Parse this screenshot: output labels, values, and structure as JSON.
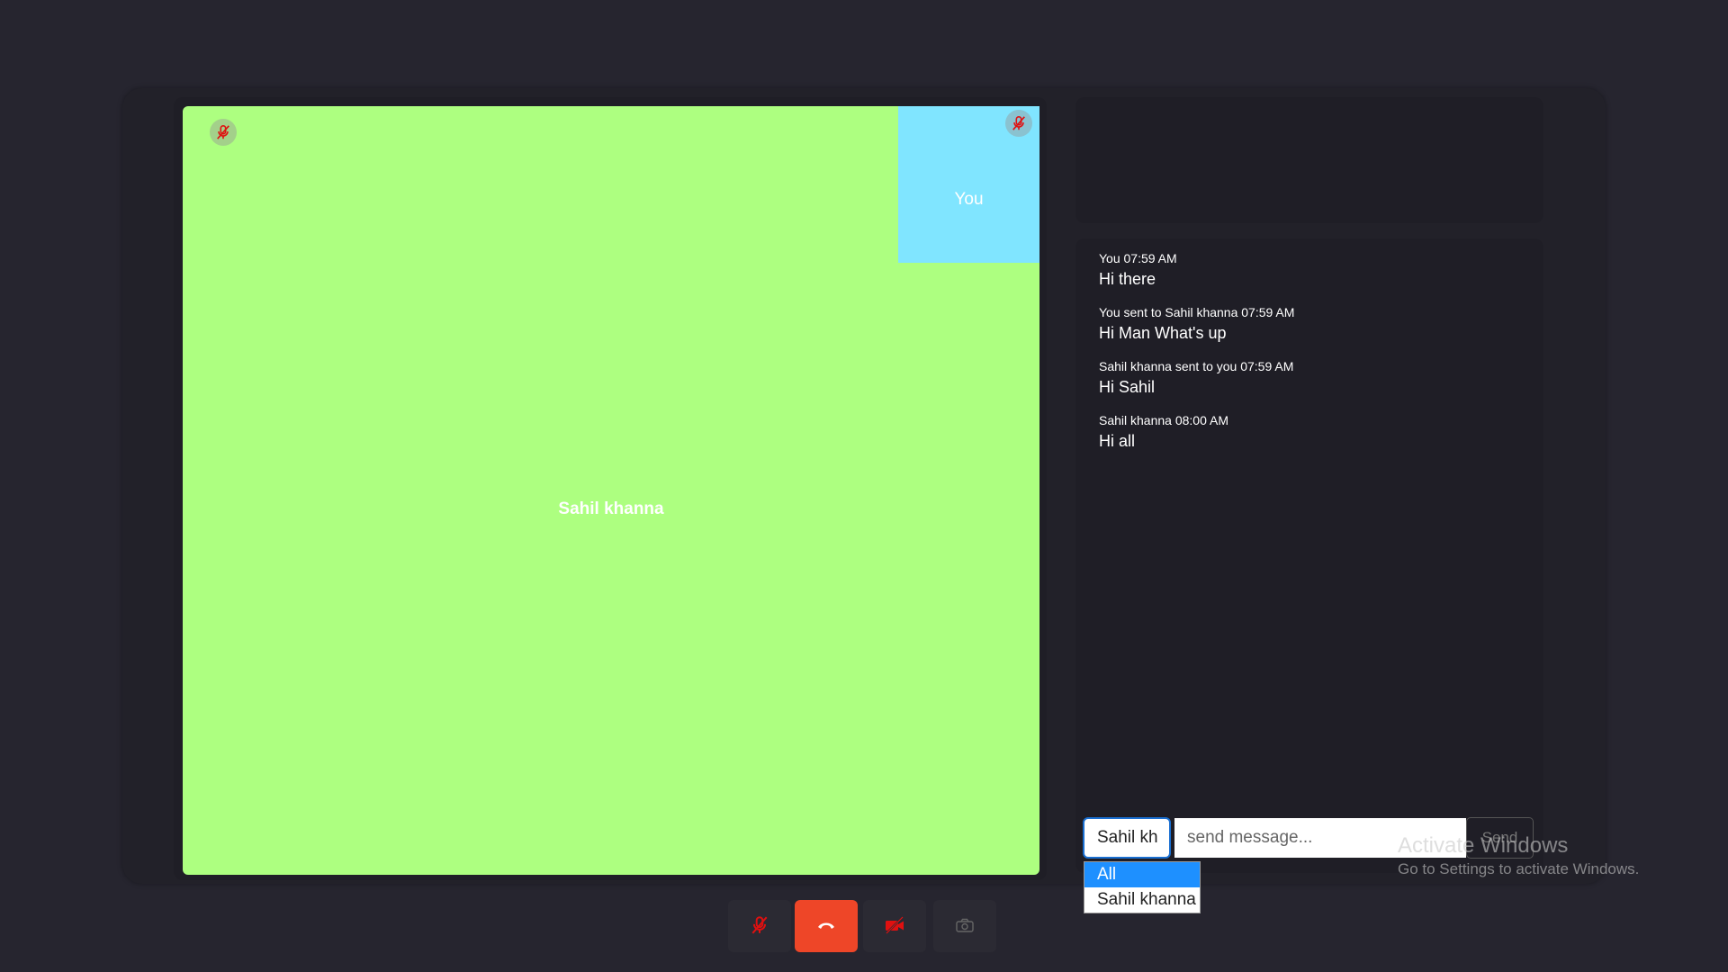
{
  "stage": {
    "main_participant": {
      "name": "Sahil khanna",
      "tile_color": "#adff80",
      "mic": "muted"
    },
    "self": {
      "name": "You",
      "tile_color": "#80e5ff",
      "mic": "muted"
    }
  },
  "chat": {
    "messages": [
      {
        "meta": "You 07:59 AM",
        "text": "Hi there"
      },
      {
        "meta": "You sent to Sahil khanna 07:59 AM",
        "text": "Hi Man What's up"
      },
      {
        "meta": "Sahil khanna sent to you 07:59 AM",
        "text": "Hi Sahil"
      },
      {
        "meta": "Sahil khanna 08:00 AM",
        "text": "Hi all"
      }
    ],
    "composer": {
      "recipient_value": "Sahil kh",
      "placeholder": "send message...",
      "send_label": "Send"
    },
    "recipient_options": [
      {
        "label": "All",
        "selected": true
      },
      {
        "label": "Sahil khanna",
        "selected": false
      }
    ]
  },
  "controls": {
    "mic": {
      "icon": "mic-off-icon",
      "state": "muted"
    },
    "end_call": {
      "icon": "phone-hangup-icon",
      "color": "#ee4628"
    },
    "camera": {
      "icon": "video-off-icon",
      "state": "off"
    },
    "screenshot": {
      "icon": "camera-icon"
    }
  },
  "watermark": {
    "title": "Activate Windows",
    "subtitle": "Go to Settings to activate Windows."
  }
}
